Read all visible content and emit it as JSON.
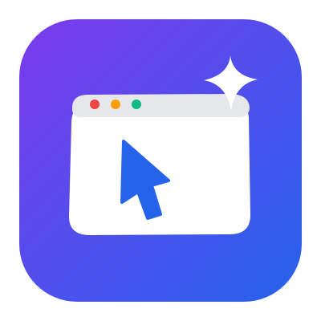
{
  "app_icon": {
    "icon_name": "browser-window-cursor-sparkle-icon",
    "colors": {
      "gradient_start": "#7C3AED",
      "gradient_end": "#2563EB",
      "window_body": "#FFFFFF",
      "title_bar": "#E5E7EB",
      "dot_red": "#EF4444",
      "dot_orange": "#F59E0B",
      "dot_green": "#10B981",
      "cursor": "#2563EB",
      "sparkle": "#FFFFFF"
    }
  }
}
